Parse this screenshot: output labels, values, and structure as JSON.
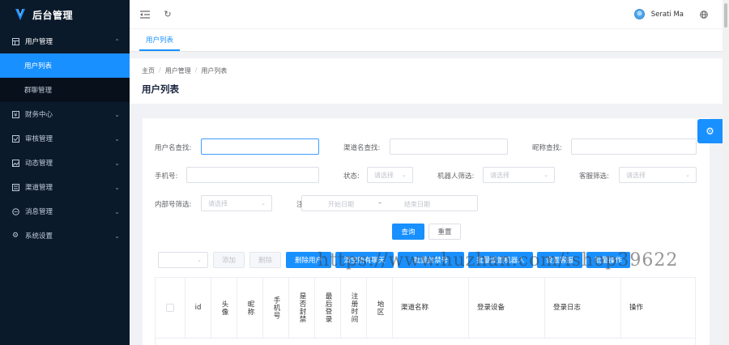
{
  "app": {
    "title": "后台管理"
  },
  "sidebar": {
    "groups": [
      {
        "label": "用户管理",
        "icon": "table-icon",
        "open": true,
        "children": [
          {
            "label": "用户列表",
            "active": true
          },
          {
            "label": "群聊管理",
            "active": false
          }
        ]
      },
      {
        "label": "财务中心",
        "icon": "finance-icon"
      },
      {
        "label": "审核管理",
        "icon": "checklist-icon"
      },
      {
        "label": "动态管理",
        "icon": "image-icon"
      },
      {
        "label": "渠道管理",
        "icon": "channel-icon"
      },
      {
        "label": "消息管理",
        "icon": "message-icon"
      },
      {
        "label": "系统设置",
        "icon": "gear-icon"
      }
    ]
  },
  "topbar": {
    "username": "Serati Ma"
  },
  "tabs": [
    {
      "label": "用户列表",
      "active": true
    }
  ],
  "breadcrumb": [
    "主页",
    "用户管理",
    "用户列表"
  ],
  "page_title": "用户列表",
  "filters": {
    "username_label": "用户名查找:",
    "channel_label": "渠道名查找:",
    "nickname_label": "昵称查找:",
    "phone_label": "手机号:",
    "status_label": "状态:",
    "status_placeholder": "请选择",
    "robot_label": "机器人筛选:",
    "robot_placeholder": "请选择",
    "service_label": "客服筛选:",
    "service_placeholder": "请选择",
    "internal_label": "内部号筛选:",
    "internal_placeholder": "请选择",
    "date_label": "注",
    "start_date_placeholder": "开始日期",
    "date_separator": "–",
    "end_date_placeholder": "结束日期"
  },
  "actions": {
    "query": "查询",
    "reset": "重置",
    "add": "添加",
    "delete": "删除",
    "remove_user": "删除用户",
    "btn_5": "清空所有聊天",
    "btn_6": "批量封禁号",
    "btn_7": "批量设置机器人",
    "btn_8": "设置客服",
    "btn_9": "批量操作"
  },
  "table": {
    "columns": [
      "id",
      "头像",
      "昵称",
      "手机号",
      "是否封禁",
      "最后登录",
      "注册时间",
      "地区",
      "渠道名称",
      "登录设备",
      "登录日志",
      "操作"
    ]
  },
  "watermark": "https://www.huzhan.com/ishop39622",
  "colors": {
    "primary": "#1890ff",
    "sidebar_bg": "#0b1a2b"
  }
}
